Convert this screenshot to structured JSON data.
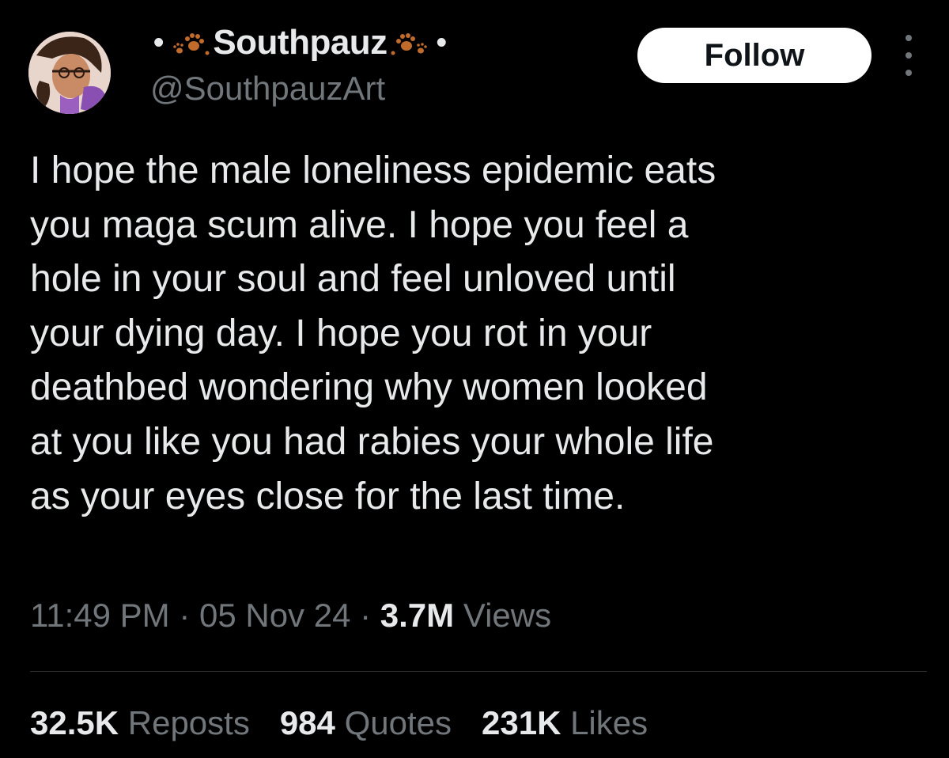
{
  "colors": {
    "background": "#000000",
    "text_primary": "#e7e9ea",
    "text_secondary": "#71767b",
    "follow_button_bg": "#ffffff",
    "follow_button_text": "#0f1419",
    "divider": "#2f3336",
    "paw_icon": "#c06a2b"
  },
  "author": {
    "display_name_prefix": "•",
    "display_name": "Southpauz",
    "display_name_suffix": "•",
    "handle": "@SouthpauzArt",
    "name_icons": [
      "paw-prints-icon",
      "paw-prints-icon"
    ],
    "avatar_icon": "avatar-illustration"
  },
  "header": {
    "follow_label": "Follow",
    "more_icon": "more-vertical-icon"
  },
  "tweet": {
    "text": "I hope the male loneliness epidemic eats\nyou maga scum alive. I hope you feel a\nhole in your soul and feel unloved until\nyour dying day. I hope you rot in your\ndeathbed wondering why women looked\nat you like you had rabies your whole life\nas your eyes close for the last time."
  },
  "meta": {
    "time": "11:49 PM",
    "separator": " · ",
    "date": "05 Nov 24",
    "views_count": "3.7M",
    "views_label": "Views"
  },
  "stats": {
    "reposts_count": "32.5K",
    "reposts_label": "Reposts",
    "quotes_count": "984",
    "quotes_label": "Quotes",
    "likes_count": "231K",
    "likes_label": "Likes"
  }
}
